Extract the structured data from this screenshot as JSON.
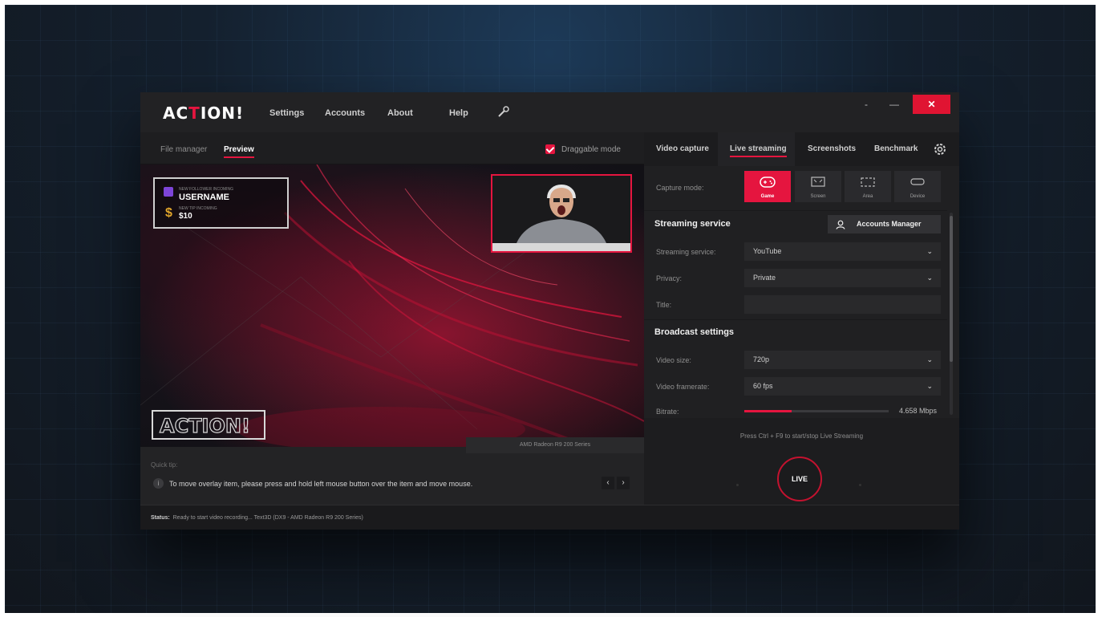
{
  "app": {
    "logo": {
      "pre": "AC",
      "accent": "T",
      "post": "ION!"
    },
    "menu": [
      "Settings",
      "Accounts",
      "About",
      "Help"
    ],
    "window": {
      "minimize": "-",
      "maximize": "—",
      "close": "✕"
    }
  },
  "left": {
    "tabs": [
      "File manager",
      "Preview"
    ],
    "active_tab": "Preview",
    "draggable_mode": {
      "label": "Draggable mode",
      "checked": true
    },
    "overlay": {
      "follower_caption": "NEW FOLLOWER INCOMING",
      "follower_name": "USERNAME",
      "tip_caption": "NEW TIP INCOMING",
      "tip_amount": "$10",
      "currency_symbol": "$"
    },
    "watermark": "ACTION!",
    "gpu": "AMD Radeon R9 200 Series",
    "quick_tip": {
      "title": "Quick tip:",
      "text": "To move overlay item, please press and hold left mouse button over the item and move mouse.",
      "prev": "‹",
      "next": "›"
    }
  },
  "right": {
    "tabs": [
      "Video capture",
      "Live streaming",
      "Screenshots",
      "Benchmark"
    ],
    "active_tab": "Live streaming",
    "capture_mode": {
      "label": "Capture mode:",
      "modes": [
        "Game",
        "Screen",
        "Area",
        "Device"
      ],
      "active": "Game"
    },
    "streaming_service": {
      "title": "Streaming service",
      "accounts_button": "Accounts Manager",
      "service_label": "Streaming service:",
      "service_value": "YouTube",
      "privacy_label": "Privacy:",
      "privacy_value": "Private",
      "title_label": "Title:",
      "title_value": ""
    },
    "broadcast": {
      "title": "Broadcast settings",
      "video_size_label": "Video size:",
      "video_size_value": "720p",
      "framerate_label": "Video framerate:",
      "framerate_value": "60 fps",
      "bitrate_label": "Bitrate:",
      "bitrate_value": "4.658 Mbps",
      "bitrate_fill": 0.33
    },
    "hint": "Press Ctrl + F9 to start/stop Live Streaming",
    "live_button": "LIVE"
  },
  "status": {
    "label": "Status:",
    "text": "Ready to start video recording... Text3D (DX9 - AMD Radeon R9 200 Series)"
  },
  "colors": {
    "accent": "#e5153f",
    "twitch": "#7d45d8",
    "tip": "#e0a52b"
  }
}
